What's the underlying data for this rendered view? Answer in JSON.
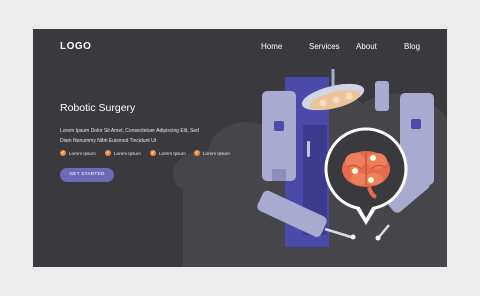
{
  "header": {
    "logo": "LOGO",
    "nav": [
      "Home",
      "Services",
      "About",
      "Blog"
    ]
  },
  "hero": {
    "title": "Robotic Surgery",
    "description": "Lorem Ipsum Dolor Sit Amet, Consectetuer Adipiscing Elit, Sed Diam Nonummy Nibh Euismod Tincidunt Ut",
    "features": [
      "Lorem Ipsum",
      "Lorem Ipsum",
      "Lorem Ipsum",
      "Lorem Ipsum"
    ],
    "cta_label": "GET STARTED"
  },
  "illustration": {
    "subject": "robotic surgery arms with surgical lamp and brain callout",
    "colors": {
      "background": "#3a393d",
      "cloud": "#46454a",
      "arm": "#a9aacf",
      "lamp": "#ecc49b",
      "callout_border": "#ffffff",
      "brain": "#e86a4c",
      "accent": "#f08a3c",
      "column": "#4a4aa8"
    }
  },
  "colors": {
    "page_background": "#ececec",
    "cta": "#6c6ab6",
    "check": "#f08a3c"
  }
}
